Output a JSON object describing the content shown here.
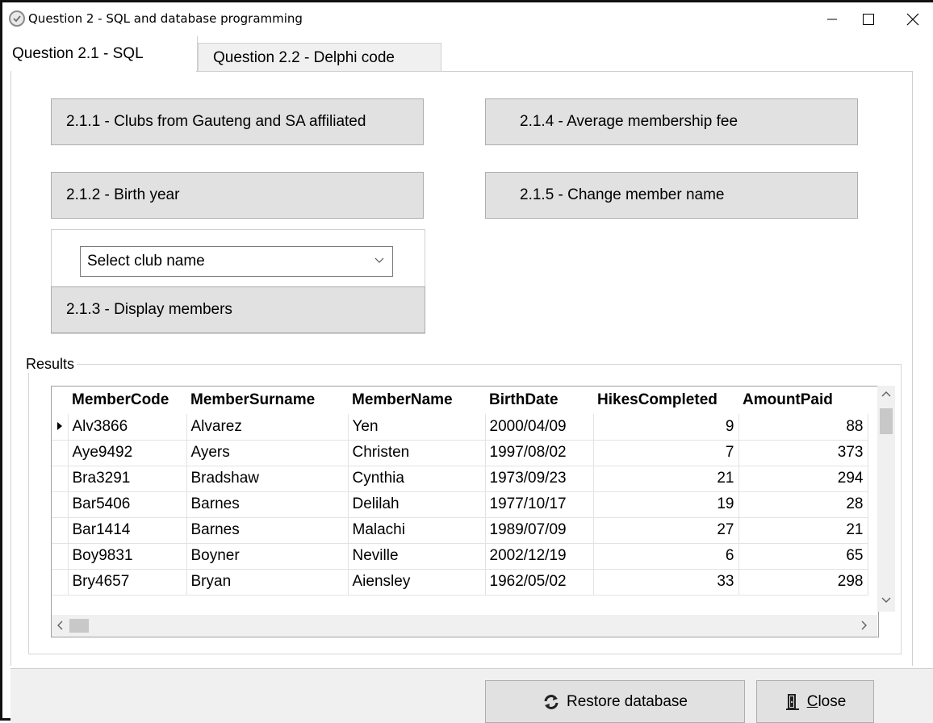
{
  "window": {
    "title": "Question 2 - SQL and database programming",
    "icon": "check-circle-icon"
  },
  "tabs": [
    {
      "label": "Question 2.1 - SQL",
      "active": true
    },
    {
      "label": "Question 2.2 - Delphi code",
      "active": false
    }
  ],
  "buttons": {
    "b211": "2.1.1 - Clubs from Gauteng and SA affiliated",
    "b212": "2.1.2 - Birth year",
    "b213": "2.1.3 - Display members",
    "b214": "2.1.4 - Average membership fee",
    "b215": "2.1.5 - Change member name"
  },
  "club_select": {
    "value": "Select club name"
  },
  "results": {
    "legend": "Results",
    "columns": [
      "MemberCode",
      "MemberSurname",
      "MemberName",
      "BirthDate",
      "HikesCompleted",
      "AmountPaid"
    ],
    "rows": [
      [
        "Alv3866",
        "Alvarez",
        "Yen",
        "2000/04/09",
        "9",
        "88"
      ],
      [
        "Aye9492",
        "Ayers",
        "Christen",
        "1997/08/02",
        "7",
        "373"
      ],
      [
        "Bra3291",
        "Bradshaw",
        "Cynthia",
        "1973/09/23",
        "21",
        "294"
      ],
      [
        "Bar5406",
        "Barnes",
        "Delilah",
        "1977/10/17",
        "19",
        "28"
      ],
      [
        "Bar1414",
        "Barnes",
        "Malachi",
        "1989/07/09",
        "27",
        "21"
      ],
      [
        "Boy9831",
        "Boyner",
        "Neville",
        "2002/12/19",
        "6",
        "65"
      ],
      [
        "Bry4657",
        "Bryan",
        "Aiensley",
        "1962/05/02",
        "33",
        "298"
      ]
    ],
    "selected_row": 0
  },
  "footer": {
    "restore_label": "Restore database",
    "restore_icon": "refresh-icon",
    "close_prefix": "",
    "close_mnemonic": "C",
    "close_rest": "lose",
    "close_icon": "door-exit-icon"
  },
  "colors": {
    "button_face": "#e1e1e1",
    "panel_bg": "#f0f0f0",
    "border": "#adadad"
  }
}
